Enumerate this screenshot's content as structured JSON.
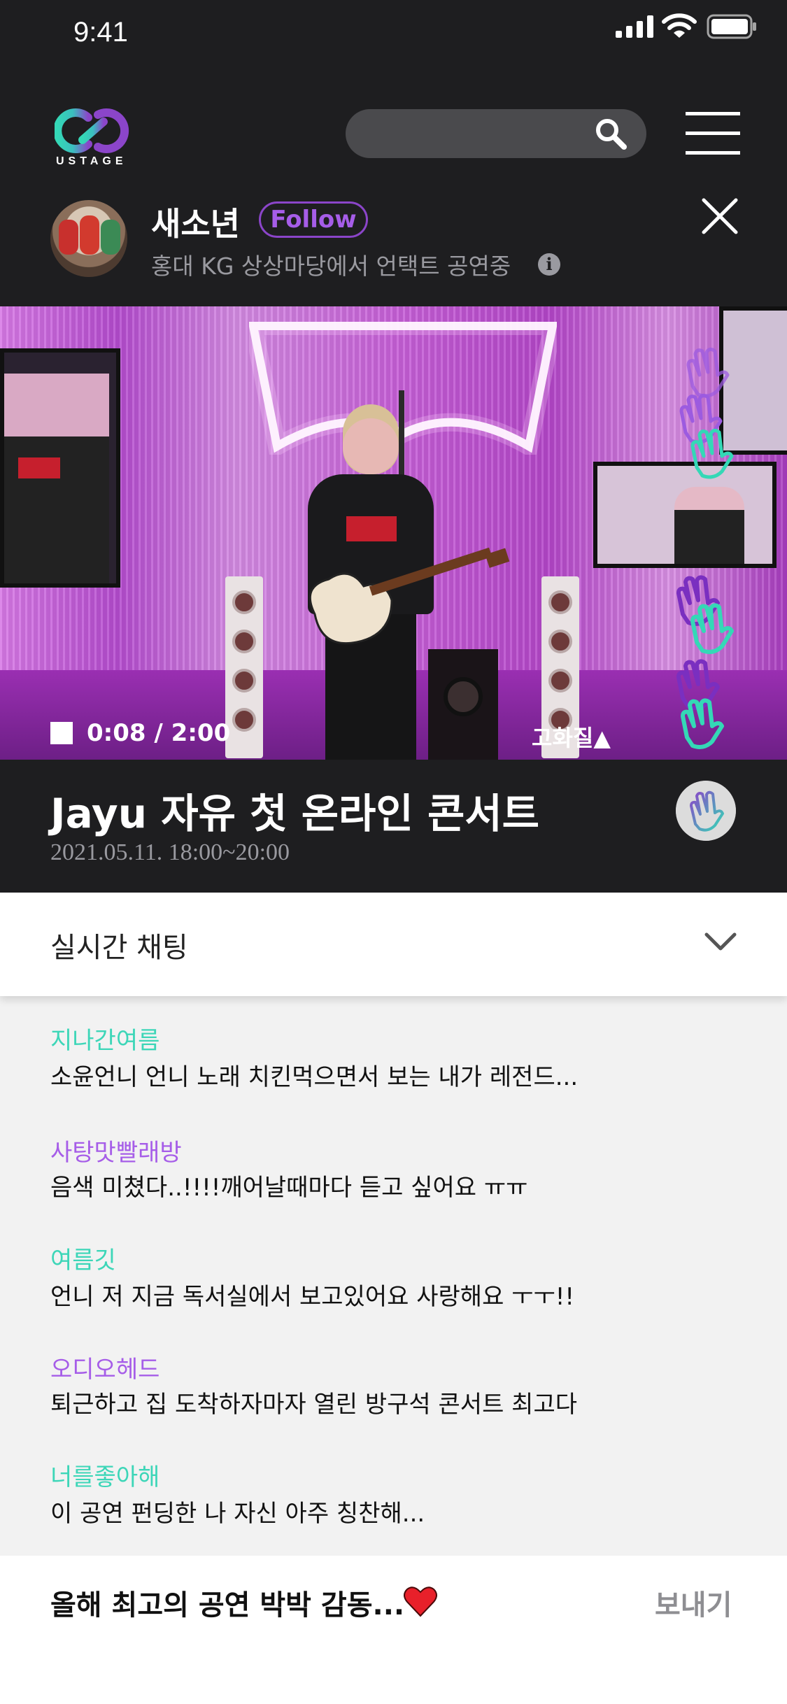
{
  "status_bar": {
    "time": "9:41"
  },
  "header": {
    "logo_text": "USTAGE",
    "icons": [
      "search-icon",
      "menu-icon"
    ]
  },
  "artist": {
    "name": "새소년",
    "follow_label": "Follow",
    "status": "홍대 KG 상상마당에서 언택트 공연중",
    "info_glyph": "i"
  },
  "player": {
    "time": "0:08 / 2:00",
    "quality_label": "고화질▲"
  },
  "concert": {
    "title": "Jayu 자유 첫 온라인 콘서트",
    "date": "2021.05.11. 18:00~20:00"
  },
  "chat": {
    "title": "실시간 채팅",
    "messages": [
      {
        "user": "지나간여름",
        "text": "소윤언니 언니 노래 치킨먹으면서 보는 내가 레전드...",
        "color": "#3dd6b8"
      },
      {
        "user": "사탕맛빨래방",
        "text": "음색 미쳤다..!!!!깨어날때마다 듣고 싶어요 ㅠㅠ",
        "color": "#a65de8"
      },
      {
        "user": "여름깃",
        "text": "언니 저 지금 독서실에서 보고있어요 사랑해요 ㅜㅜ!!",
        "color": "#3dd6b8"
      },
      {
        "user": "오디오헤드",
        "text": "퇴근하고 집 도착하자마자 열린 방구석 콘서트 최고다",
        "color": "#a65de8"
      },
      {
        "user": "너를좋아해",
        "text": "이 공연 펀딩한 나 자신 아주 칭찬해...",
        "color": "#3dd6b8"
      }
    ],
    "input_value": "올해 최고의 공연 박박 감동...",
    "send_label": "보내기"
  },
  "colors": {
    "background": "#1e1e20",
    "accent_purple": "#8b45c9",
    "accent_teal": "#3dd6b8",
    "chat_bg": "#f2f2f2"
  }
}
